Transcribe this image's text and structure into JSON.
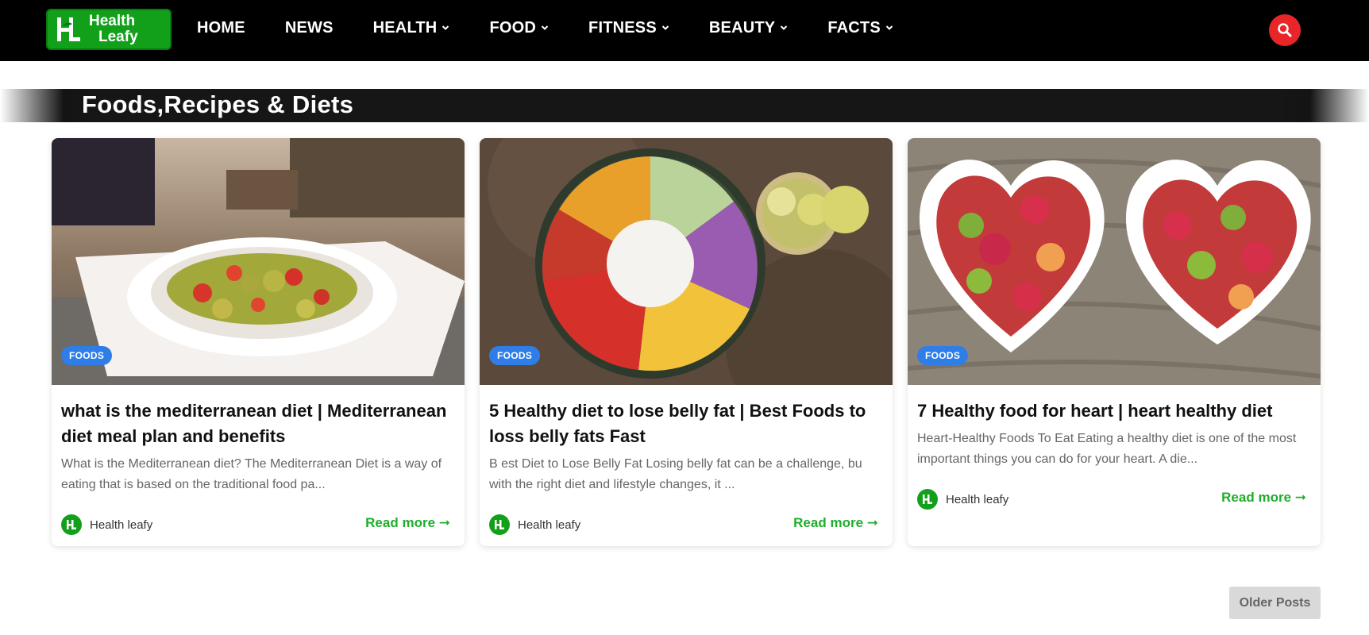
{
  "header": {
    "logo_line1": "Health",
    "logo_line2": "Leafy",
    "nav": [
      {
        "label": "HOME",
        "has_dropdown": false
      },
      {
        "label": "NEWS",
        "has_dropdown": false
      },
      {
        "label": "HEALTH",
        "has_dropdown": true
      },
      {
        "label": "FOOD",
        "has_dropdown": true
      },
      {
        "label": "FITNESS",
        "has_dropdown": true
      },
      {
        "label": "BEAUTY",
        "has_dropdown": true
      },
      {
        "label": "FACTS",
        "has_dropdown": true
      }
    ],
    "search_icon": "search-icon"
  },
  "section": {
    "title": "Foods,Recipes & Diets"
  },
  "cards": [
    {
      "badge": "FOODS",
      "title": "what is the mediterranean diet | Mediterranean diet meal plan and benefits",
      "desc": "What is the Mediterranean diet?  The Mediterranean Diet is a way of eating that is based on the traditional food pa...",
      "author": "Health leafy",
      "read_more": "Read more ➞"
    },
    {
      "badge": "FOODS",
      "title": "5 Healthy diet to lose belly fat | Best Foods to loss belly fats Fast",
      "desc": "B est Diet to Lose Belly Fat  Losing belly fat can be a challenge, bu with the right diet and lifestyle changes, it ...",
      "author": "Health leafy",
      "read_more": "Read more ➞"
    },
    {
      "badge": "FOODS",
      "title": "7 Healthy food for heart | heart healthy diet",
      "desc": "Heart-Healthy Foods To Eat  Eating a healthy diet is one of the most important things you can do for your heart. A die...",
      "author": "Health leafy",
      "read_more": "Read more ➞"
    }
  ],
  "pagination": {
    "older_label": "Older Posts"
  },
  "colors": {
    "brand_green": "#12a01a",
    "read_more_green": "#1fae2b",
    "search_red": "#e8262a",
    "badge_blue": "#2f7ee8"
  }
}
